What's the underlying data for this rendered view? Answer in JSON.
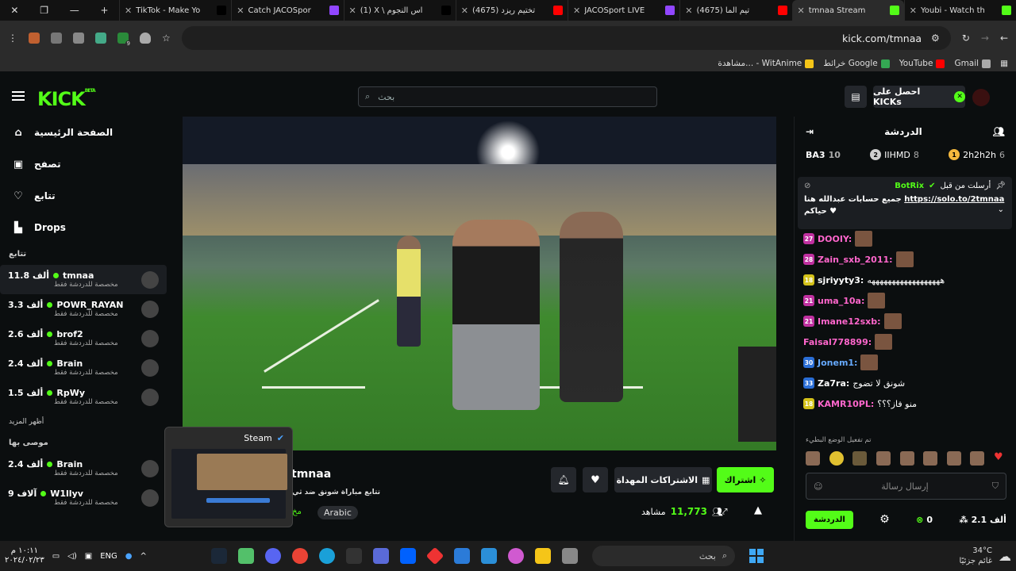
{
  "browser": {
    "tabs": [
      {
        "title": "TikTok - Make Yo",
        "color": "#000000"
      },
      {
        "title": "Catch JACOSpor",
        "color": "#9146ff"
      },
      {
        "title": "(1) X \\ اس النجوم",
        "color": "#000000"
      },
      {
        "title": "(4675) تختيم ريزد",
        "color": "#ff0000"
      },
      {
        "title": "JACOSport LIVE",
        "color": "#9146ff"
      },
      {
        "title": "(4675) تيم الما",
        "color": "#ff0000"
      },
      {
        "title": "tmnaa Stream",
        "color": "#53fc18",
        "active": true
      },
      {
        "title": "Youbi - Watch th",
        "color": "#53fc18"
      }
    ],
    "url": "kick.com/tmnaa",
    "bookmarks": [
      {
        "label": "مشاهدة... - WitAnime",
        "color": "#f5c518"
      },
      {
        "label": "خرائط Google",
        "color": "#34a853"
      },
      {
        "label": "YouTube",
        "color": "#ff0000"
      },
      {
        "label": "Gmail",
        "color": "#aaaaaa"
      }
    ],
    "extension_badge": "9"
  },
  "header": {
    "search_placeholder": "بحث",
    "get_kicks": "احصل على KICKs"
  },
  "sidebar": {
    "nav": [
      {
        "label": "الصفحة الرئيسية",
        "icon": "home-icon"
      },
      {
        "label": "تصفح",
        "icon": "browse-icon"
      },
      {
        "label": "تتابع",
        "icon": "heart-icon"
      },
      {
        "label": "Drops",
        "icon": "drops-icon"
      }
    ],
    "following_title": "تتابع",
    "following": [
      {
        "name": "tmnaa",
        "viewers": "11.8 ألف",
        "sub": "مخصصة للدردشة فقط",
        "active": true
      },
      {
        "name": "POWR_RAYAN",
        "viewers": "3.3 ألف",
        "sub": "مخصصة للدردشة فقط"
      },
      {
        "name": "brof2",
        "viewers": "2.6 ألف",
        "sub": "مخصصة للدردشة فقط"
      },
      {
        "name": "Brain",
        "viewers": "2.4 ألف",
        "sub": "مخصصة للدردشة فقط"
      },
      {
        "name": "RpWy",
        "viewers": "1.5 ألف",
        "sub": "مخصصة للدردشة فقط"
      }
    ],
    "show_more": "أظهر المزيد",
    "recommended_title": "موصى بها",
    "recommended": [
      {
        "name": "Brain",
        "viewers": "2.4 ألف",
        "sub": "مخصصة للدردشة فقط"
      },
      {
        "name": "W1llyv",
        "viewers": "9 آلاف",
        "sub": "مخصصة للدردشة فقط"
      }
    ]
  },
  "stream": {
    "name": "tmnaa",
    "title": "تتابع مباراة شونق ضد ثي",
    "category": "مخ",
    "language": "Arabic",
    "viewers": "11,773",
    "viewers_label": "مشاهد",
    "subscribe": "اشتراك",
    "gift_subs": "الاشتراكات المهداة"
  },
  "steam_popup": {
    "title": "Steam"
  },
  "chat": {
    "title": "الدردشة",
    "leaderboard": [
      {
        "rank": "1",
        "name": "2h2h2h",
        "count": "6",
        "color": "#f5b83d"
      },
      {
        "rank": "2",
        "name": "IIHMD",
        "count": "8",
        "color": "#cfcfcf"
      },
      {
        "rank": "3",
        "name": "BA3",
        "count": "10",
        "color": "#cd7f32"
      }
    ],
    "pinned": {
      "by": "أرسلت من قبل",
      "bot": "BotRix",
      "link": "https://solo.to/2tmnaa",
      "text": "جميع حسابات عبدالله هنا",
      "text2": "حياكم"
    },
    "messages": [
      {
        "badge": "27",
        "badge_color": "#c030a0",
        "name": "DOOIY:",
        "name_color": "#ff66cc",
        "text": ""
      },
      {
        "badge": "28",
        "badge_color": "#c030a0",
        "name": "Zain_sxb_2011:",
        "name_color": "#ff66cc",
        "text": ""
      },
      {
        "badge": "18",
        "badge_color": "#d4c21a",
        "name": "sjriyyty3:",
        "name_color": "#ffffff",
        "text": "ههههههههههههههههههه"
      },
      {
        "badge": "21",
        "badge_color": "#c030a0",
        "name": "uma_10a:",
        "name_color": "#ff66cc",
        "text": ""
      },
      {
        "badge": "21",
        "badge_color": "#c030a0",
        "name": "Imane12sxb:",
        "name_color": "#ff66cc",
        "text": ""
      },
      {
        "badge": "",
        "badge_color": "",
        "name": "Faisal778899:",
        "name_color": "#ff66cc",
        "text": ""
      },
      {
        "badge": "30",
        "badge_color": "#2a6ed6",
        "name": "Jonem1:",
        "name_color": "#66aaff",
        "text": ""
      },
      {
        "badge": "33",
        "badge_color": "#2a6ed6",
        "name": "Za7ra:",
        "name_color": "#ffffff",
        "text": "شونق لا تضوج"
      },
      {
        "badge": "18",
        "badge_color": "#d4c21a",
        "name": "KAMR10PL:",
        "name_color": "#ff66cc",
        "text": "منو فاز؟؟؟"
      }
    ],
    "mode_note": "تم تفعيل الوضع البطيء",
    "send_placeholder": "إرسال رسالة",
    "kicks": "0",
    "followers": "2.1 ألف",
    "chat_button": "الدردشة"
  },
  "taskbar": {
    "time": "١٠:١١ م",
    "date": "٢٠٢٤/٠٢/٢٣",
    "lang": "ENG",
    "search": "بحث",
    "weather_temp": "34°C",
    "weather_desc": "غائم جزئيًا"
  }
}
